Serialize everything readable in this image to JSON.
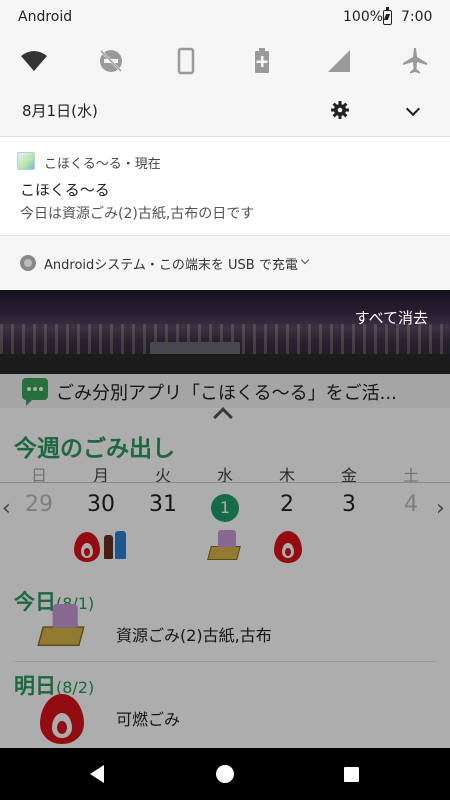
{
  "status_bar": {
    "carrier": "Android",
    "battery": "100%",
    "time": "7:00"
  },
  "quick_settings": {
    "tiles": [
      "wifi-icon",
      "do-not-disturb-icon",
      "rotation-icon",
      "battery-saver-icon",
      "cellular-icon",
      "airplane-mode-icon"
    ],
    "date": "8月1日(水)"
  },
  "notification": {
    "app_line": "こほくる〜る・現在",
    "title": "こほくる〜る",
    "body": "今日は資源ごみ(2)古紙,古布の日です"
  },
  "system_notification": {
    "text": "Androidシステム・この端末を USB で充電"
  },
  "clear_all": "すべて消去",
  "app": {
    "banner": "ごみ分別アプリ「こほくる〜る」をご活...",
    "week_title": "今週のごみ出し",
    "weekdays": [
      "日",
      "月",
      "火",
      "水",
      "木",
      "金",
      "土"
    ],
    "days": [
      "29",
      "30",
      "31",
      "1",
      "2",
      "3",
      "4"
    ],
    "today": {
      "head": "今日",
      "date": "(8/1)",
      "text": "資源ごみ(2)古紙,古布"
    },
    "tomorrow": {
      "head": "明日",
      "date": "(8/2)",
      "text": "可燃ごみ"
    },
    "accent_color": "#2b9a5c"
  }
}
